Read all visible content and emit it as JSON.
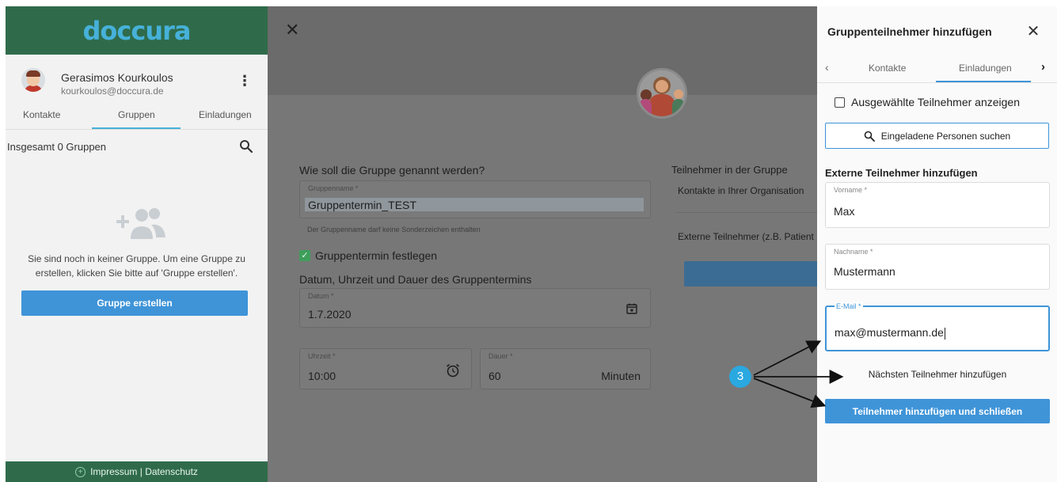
{
  "sidebar": {
    "logo": "doccura",
    "user": {
      "name": "Gerasimos Kourkoulos",
      "email": "kourkoulos@doccura.de"
    },
    "tabs": [
      {
        "label": "Kontakte"
      },
      {
        "label": "Gruppen"
      },
      {
        "label": "Einladungen"
      }
    ],
    "active_tab": "Gruppen",
    "groups_count": "Insgesamt 0 Gruppen",
    "empty_text": "Sie sind noch in keiner Gruppe. Um eine Gruppe zu erstellen, klicken Sie bitte auf 'Gruppe erstellen'.",
    "create_button": "Gruppe erstellen",
    "footer": "Impressum | Datenschutz"
  },
  "dialog": {
    "name_question": "Wie soll die Gruppe genannt werden?",
    "name_label": "Gruppenname *",
    "name_value": "Gruppentermin_TEST",
    "name_hint": "Der Gruppenname darf keine Sonderzeichen enthalten",
    "set_termin_label": "Gruppentermin festlegen",
    "date_question": "Datum, Uhrzeit und Dauer des Gruppentermins",
    "date_label": "Datum *",
    "date_value": "1.7.2020",
    "time_label": "Uhrzeit *",
    "time_value": "10:00",
    "duration_label": "Dauer *",
    "duration_value": "60",
    "duration_unit": "Minuten",
    "participants_title": "Teilnehmer in der Gruppe",
    "contacts_org": "Kontakte in Ihrer Organisation",
    "external_participants": "Externe Teilnehmer (z.B. Patient"
  },
  "panel": {
    "title": "Gruppenteilnehmer hinzufügen",
    "tabs": [
      {
        "label": "Kontakte"
      },
      {
        "label": "Einladungen"
      }
    ],
    "active_tab": "Einladungen",
    "show_selected": "Ausgewählte Teilnehmer anzeigen",
    "search_invited": "Eingeladene Personen suchen",
    "external_title": "Externe Teilnehmer hinzufügen",
    "first_name_label": "Vorname *",
    "first_name_value": "Max",
    "last_name_label": "Nachname *",
    "last_name_value": "Mustermann",
    "email_label": "E-Mail *",
    "email_value": "max@mustermann.de",
    "next_participant": "Nächsten Teilnehmer hinzufügen",
    "add_close_button": "Teilnehmer hinzufügen und schließen"
  },
  "annotation": {
    "number": "3",
    "color": "#2aa8e0"
  },
  "colors": {
    "brand_green": "#2f6b4b",
    "accent_blue": "#3f94d8",
    "logo_blue": "#46b1d9"
  }
}
